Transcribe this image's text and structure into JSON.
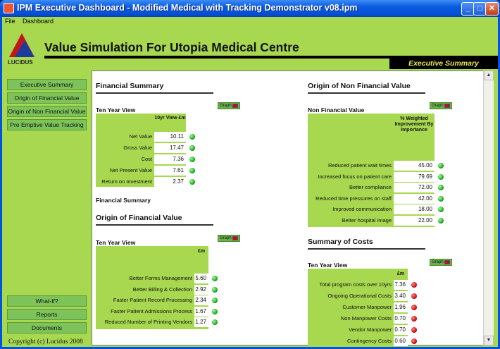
{
  "window": {
    "title": "IPM Executive Dashboard - Modified Medical with Tracking Demonstrator v08.ipm"
  },
  "menu": [
    "File",
    "Dashboard"
  ],
  "header": {
    "logo_text": "LUCIDUS",
    "title": "Value Simulation For Utopia Medical Centre",
    "section": "Executive Summary"
  },
  "sidebar": {
    "items": [
      "Executive Summary",
      "Origin of Financial Value",
      "Origin of Non Financial Value",
      "Pre Emptive Value Tracking"
    ],
    "bottom_items": [
      "What-If?",
      "Reports",
      "Documents"
    ],
    "copyright": "Copyright (c) Lucidus 2008"
  },
  "graph_label": "Graph",
  "financial_summary": {
    "title": "Financial Summary",
    "subtitle": "Ten Year View",
    "col_head": "10yr View £m",
    "rows": [
      {
        "label": "Net Value",
        "value": "10.11",
        "status": "green"
      },
      {
        "label": "Gross Value",
        "value": "17.47",
        "status": "green"
      },
      {
        "label": "Cost",
        "value": "7.36",
        "status": "green"
      },
      {
        "label": "Net Present Value",
        "value": "7.61",
        "status": "green"
      },
      {
        "label": "Return on Investment",
        "value": "2.37",
        "status": "green"
      }
    ],
    "footer_label": "Financial Summary"
  },
  "origin_financial": {
    "title": "Origin of Financial Value",
    "subtitle": "Ten Year View",
    "col_head": "£m",
    "rows": [
      {
        "label": "Better Forms Management",
        "value": "5.60",
        "status": "green"
      },
      {
        "label": "Better Billing & Collection",
        "value": "2.92",
        "status": "green"
      },
      {
        "label": "Faster Patient Record Processing",
        "value": "2.34",
        "status": "green"
      },
      {
        "label": "Faster Patient Admissions Process",
        "value": "1.67",
        "status": "green"
      },
      {
        "label": "Reduced Number of Printing Vendors",
        "value": "1.27",
        "status": "green"
      }
    ]
  },
  "origin_non_financial": {
    "title": "Origin of Non Financial Value",
    "subtitle": "Non Financial Value",
    "col_head": "% Weighted Improvement By Importance",
    "rows": [
      {
        "label": "Reduced patient wait times",
        "value": "45.00",
        "status": "green"
      },
      {
        "label": "Increased focus on patient care",
        "value": "79.69",
        "status": "green"
      },
      {
        "label": "Better compliance",
        "value": "72.00",
        "status": "green"
      },
      {
        "label": "Reduced time pressures on staff",
        "value": "42.00",
        "status": "green"
      },
      {
        "label": "Improved communication",
        "value": "18.00",
        "status": "green"
      },
      {
        "label": "Better hospital image",
        "value": "22.00",
        "status": "green"
      }
    ]
  },
  "summary_costs": {
    "title": "Summary of Costs",
    "subtitle": "Ten Year View",
    "col_head": "£m",
    "rows": [
      {
        "label": "Total program costs over 10yrs",
        "value": "7.36",
        "status": "red"
      },
      {
        "label": "Ongoing Operational Costs",
        "value": "3.40",
        "status": "red"
      },
      {
        "label": "Customer Manpower",
        "value": "1.96",
        "status": "red"
      },
      {
        "label": "Non Manpower Costs",
        "value": "0.70",
        "status": "red"
      },
      {
        "label": "Vendor Manpower",
        "value": "0.70",
        "status": "red"
      },
      {
        "label": "Contingency Costs",
        "value": "0.60",
        "status": "red"
      }
    ]
  }
}
